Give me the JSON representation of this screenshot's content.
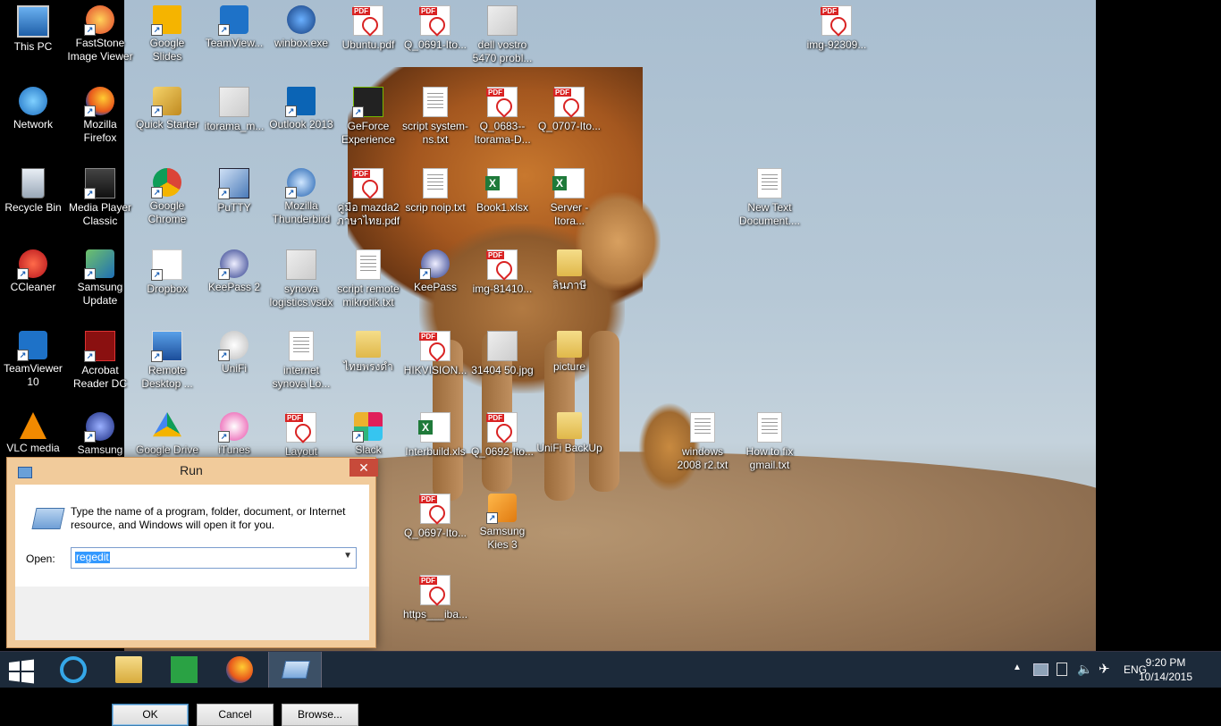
{
  "desktop": {
    "icons": [
      {
        "label": "This PC",
        "type": "pc"
      },
      {
        "label": "FastStone Image Viewer",
        "type": "app"
      },
      {
        "label": "Google Slides",
        "type": "app"
      },
      {
        "label": "TeamView...",
        "type": "app"
      },
      {
        "label": "winbox.exe",
        "type": "app"
      },
      {
        "label": "Ubuntu.pdf",
        "type": "pdf"
      },
      {
        "label": "Q_0691-Ito...",
        "type": "pdf"
      },
      {
        "label": "dell vostro 5470 probl...",
        "type": "img"
      },
      {
        "label": "img-92309...",
        "type": "pdf"
      },
      {
        "label": "Network",
        "type": "net"
      },
      {
        "label": "Mozilla Firefox",
        "type": "app"
      },
      {
        "label": "Quick Starter",
        "type": "app"
      },
      {
        "label": "itorama_m...",
        "type": "img"
      },
      {
        "label": "Outlook 2013",
        "type": "app"
      },
      {
        "label": "GeForce Experience",
        "type": "app"
      },
      {
        "label": "script system-ns.txt",
        "type": "txt"
      },
      {
        "label": "Q_0683--Itorama-D...",
        "type": "pdf"
      },
      {
        "label": "Q_0707-Ito...",
        "type": "pdf"
      },
      {
        "label": "Recycle Bin",
        "type": "bin"
      },
      {
        "label": "Media Player Classic",
        "type": "app"
      },
      {
        "label": "Google Chrome",
        "type": "app"
      },
      {
        "label": "PuTTY",
        "type": "app"
      },
      {
        "label": "Mozilla Thunderbird",
        "type": "app"
      },
      {
        "label": "คู่มือ mazda2 ภาษาไทย.pdf",
        "type": "pdf"
      },
      {
        "label": "scrip noip.txt",
        "type": "txt"
      },
      {
        "label": "Book1.xlsx",
        "type": "xls"
      },
      {
        "label": "Server - Itora...",
        "type": "xls"
      },
      {
        "label": "New Text Document....",
        "type": "txt"
      },
      {
        "label": "CCleaner",
        "type": "app"
      },
      {
        "label": "Samsung Update",
        "type": "app"
      },
      {
        "label": "Dropbox",
        "type": "app"
      },
      {
        "label": "KeePass 2",
        "type": "app"
      },
      {
        "label": "synova logistics.vsdx",
        "type": "img"
      },
      {
        "label": "script remote mikrotik.txt",
        "type": "txt"
      },
      {
        "label": "KeePass",
        "type": "app"
      },
      {
        "label": "img-81410...",
        "type": "pdf"
      },
      {
        "label": "ลินภาษี",
        "type": "folder"
      },
      {
        "label": "TeamViewer 10",
        "type": "app"
      },
      {
        "label": "Acrobat Reader DC",
        "type": "app"
      },
      {
        "label": "Remote Desktop ...",
        "type": "app"
      },
      {
        "label": "UniFi",
        "type": "app"
      },
      {
        "label": "internet synova Lo...",
        "type": "txt"
      },
      {
        "label": "ไทยพรงดำ",
        "type": "folder"
      },
      {
        "label": "HIKVISION...",
        "type": "pdf"
      },
      {
        "label": "31404 50.jpg",
        "type": "img"
      },
      {
        "label": "picture",
        "type": "folder"
      },
      {
        "label": "VLC media",
        "type": "app"
      },
      {
        "label": "Samsung",
        "type": "app"
      },
      {
        "label": "Google Drive",
        "type": "app"
      },
      {
        "label": "iTunes",
        "type": "app"
      },
      {
        "label": "Layout",
        "type": "pdf"
      },
      {
        "label": "Slack",
        "type": "app"
      },
      {
        "label": "Interbuild.xls",
        "type": "xls"
      },
      {
        "label": "Q_0692-Ito...",
        "type": "pdf"
      },
      {
        "label": "UniFi BackUp",
        "type": "folder"
      },
      {
        "label": "windows 2008 r2.txt",
        "type": "txt"
      },
      {
        "label": "How to fix gmail.txt",
        "type": "txt"
      },
      {
        "label": "Q_0697-Ito...",
        "type": "pdf"
      },
      {
        "label": "Samsung Kies 3",
        "type": "app"
      },
      {
        "label": "https___iba...",
        "type": "pdf"
      }
    ]
  },
  "run_dialog": {
    "title": "Run",
    "close_glyph": "✕",
    "description": "Type the name of a program, folder, document, or Internet resource, and Windows will open it for you.",
    "open_label": "Open:",
    "open_value": "regedit",
    "dropdown_glyph": "▼",
    "ok_label": "OK",
    "cancel_label": "Cancel",
    "browse_label": "Browse..."
  },
  "taskbar": {
    "pinned": [
      "internet-explorer",
      "file-explorer",
      "store",
      "firefox",
      "run"
    ],
    "active": "run",
    "language": "ENG",
    "time": "9:20 PM",
    "date": "10/14/2015"
  },
  "colors": {
    "taskbar": "#1c2a3a",
    "dialog_frame": "#f1cb9b",
    "close_button": "#c74a3a",
    "selection": "#3399ff"
  }
}
